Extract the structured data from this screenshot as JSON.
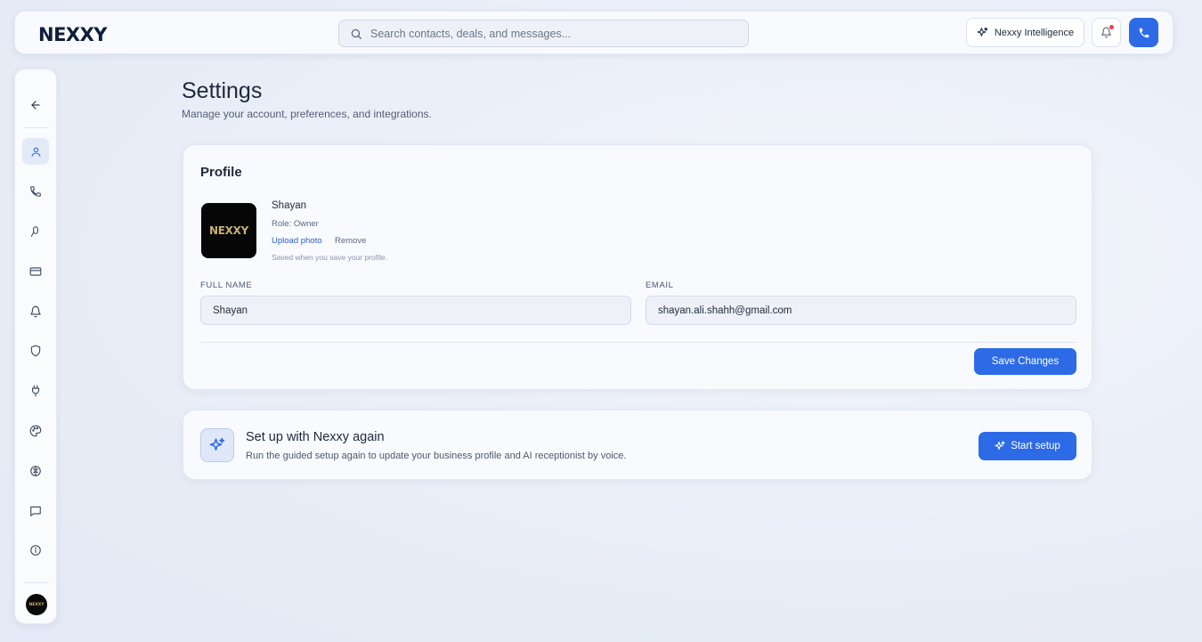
{
  "app": {
    "logo": "NEXXY",
    "search_placeholder": "Search contacts, deals, and messages...",
    "intelligence_label": "Nexxy Intelligence"
  },
  "sidebar": {
    "items": [
      {
        "name": "back",
        "icon": "arrow-left-icon"
      },
      {
        "name": "profile",
        "icon": "user-icon",
        "active": true
      },
      {
        "name": "phone",
        "icon": "phone-icon"
      },
      {
        "name": "voice",
        "icon": "pen-icon"
      },
      {
        "name": "billing",
        "icon": "credit-card-icon"
      },
      {
        "name": "notifications",
        "icon": "bell-icon"
      },
      {
        "name": "security",
        "icon": "shield-icon"
      },
      {
        "name": "integrations",
        "icon": "plug-icon"
      },
      {
        "name": "appearance",
        "icon": "palette-icon"
      },
      {
        "name": "ai",
        "icon": "brain-icon"
      },
      {
        "name": "messages",
        "icon": "message-icon"
      },
      {
        "name": "about",
        "icon": "info-icon"
      }
    ],
    "avatar_text": "NEXXY"
  },
  "page": {
    "title": "Settings",
    "subtitle": "Manage your account, preferences, and integrations."
  },
  "profile": {
    "section_title": "Profile",
    "avatar_text": "NEXXY",
    "name": "Shayan",
    "role": "Role: Owner",
    "upload_label": "Upload photo",
    "remove_label": "Remove",
    "hint": "Saved when you save your profile.",
    "full_name_label": "FULL NAME",
    "full_name_value": "Shayan",
    "email_label": "EMAIL",
    "email_value": "shayan.ali.shahh@gmail.com",
    "save_label": "Save Changes"
  },
  "setup": {
    "title": "Set up with Nexxy again",
    "description": "Run the guided setup again to update your business profile and AI receptionist by voice.",
    "button_label": "Start setup"
  },
  "colors": {
    "accent": "#2d6be6",
    "background": "#e9eef8",
    "notification_dot": "#ef4444"
  }
}
